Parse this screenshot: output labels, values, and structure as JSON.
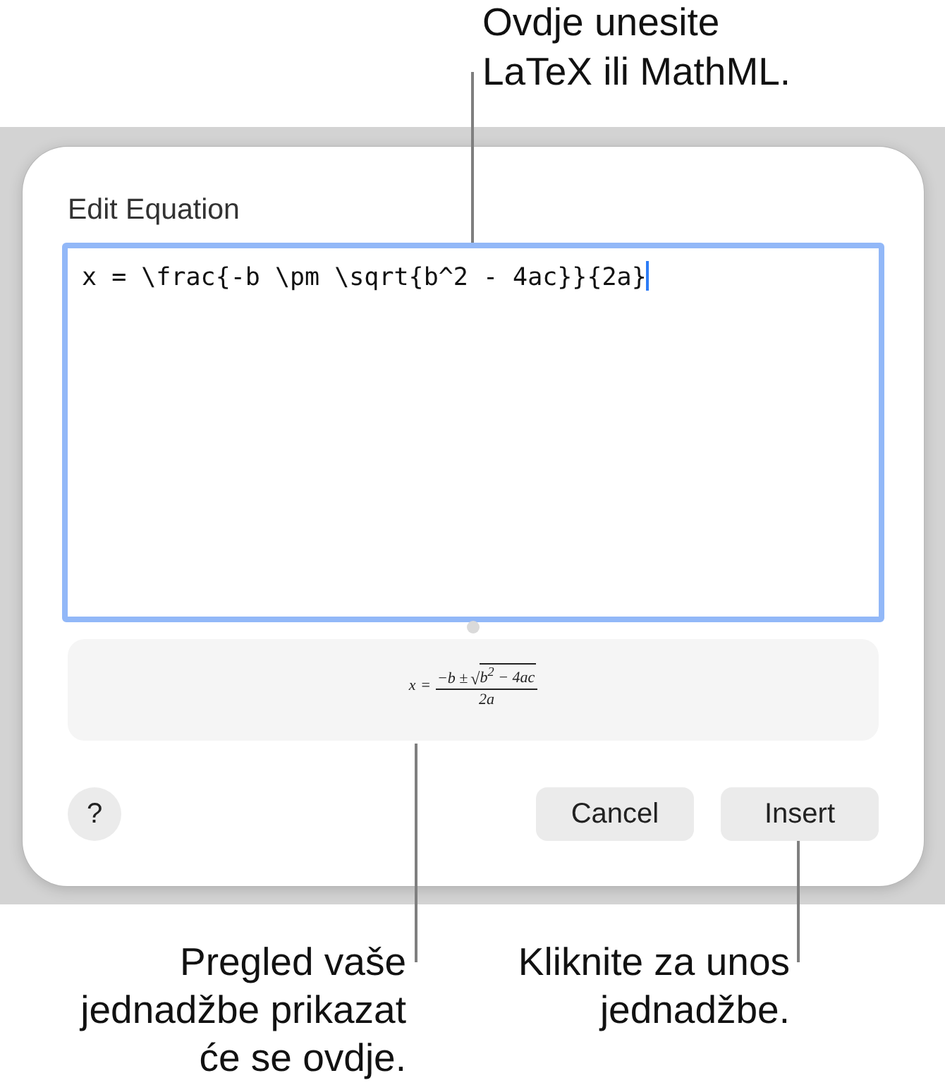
{
  "top_callout": {
    "text": "Ovdje unesite\nLaTeX ili MathML."
  },
  "dialog": {
    "title": "Edit Equation",
    "editor": {
      "value": "x = \\frac{-b \\pm \\sqrt{b^2 - 4ac}}{2a}",
      "focused": true
    },
    "preview": {
      "lhs": "x",
      "relation": "=",
      "numerator": "−b ±",
      "radical": "√",
      "radicand": "b$^{2}$ − 4ac",
      "denominator": "2a"
    },
    "buttons": [
      {
        "kind": "help",
        "label": "?"
      },
      {
        "kind": "push",
        "label": "Cancel"
      },
      {
        "kind": "push",
        "label": "Insert"
      }
    ]
  },
  "bottom_callouts": [
    {
      "text": "Pregled vaše\njednadžbe prikazat\nće se ovdje."
    },
    {
      "text": "Kliknite za unos\njednadžbe."
    }
  ]
}
